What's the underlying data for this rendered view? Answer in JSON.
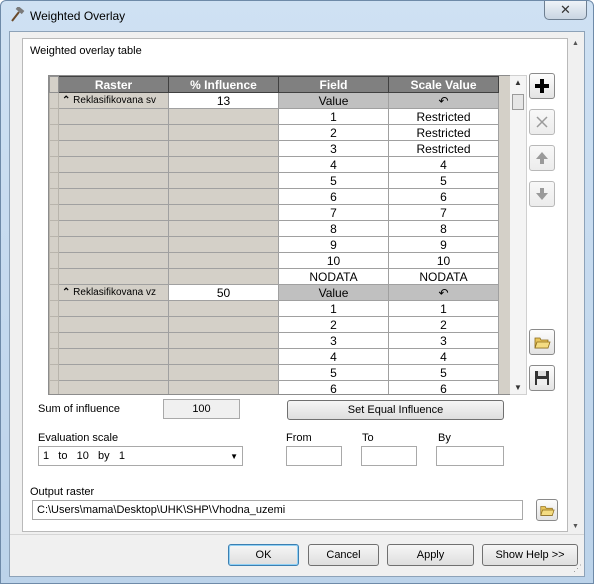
{
  "window": {
    "title": "Weighted Overlay",
    "close_glyph": "✕"
  },
  "panel": {
    "table_label": "Weighted overlay table",
    "columns": [
      "Raster",
      "% Influence",
      "Field",
      "Scale Value"
    ],
    "groups": [
      {
        "raster": "Reklasifikovana sv",
        "influence": "13",
        "field_header": "Value",
        "scale_header": "↶",
        "rows": [
          {
            "field": "1",
            "scale": "Restricted"
          },
          {
            "field": "2",
            "scale": "Restricted"
          },
          {
            "field": "3",
            "scale": "Restricted"
          },
          {
            "field": "4",
            "scale": "4"
          },
          {
            "field": "5",
            "scale": "5"
          },
          {
            "field": "6",
            "scale": "6"
          },
          {
            "field": "7",
            "scale": "7"
          },
          {
            "field": "8",
            "scale": "8"
          },
          {
            "field": "9",
            "scale": "9"
          },
          {
            "field": "10",
            "scale": "10"
          },
          {
            "field": "NODATA",
            "scale": "NODATA"
          }
        ]
      },
      {
        "raster": "Reklasifikovana vz",
        "influence": "50",
        "field_header": "Value",
        "scale_header": "↶",
        "rows": [
          {
            "field": "1",
            "scale": "1"
          },
          {
            "field": "2",
            "scale": "2"
          },
          {
            "field": "3",
            "scale": "3"
          },
          {
            "field": "4",
            "scale": "4"
          },
          {
            "field": "5",
            "scale": "5"
          },
          {
            "field": "6",
            "scale": "6"
          }
        ]
      }
    ],
    "sum_label": "Sum of influence",
    "sum_value": "100",
    "set_equal_label": "Set Equal Influence",
    "eval_label": "Evaluation scale",
    "eval_value": "1   to   10   by   1",
    "from_label": "From",
    "to_label": "To",
    "by_label": "By",
    "from_value": "",
    "to_value": "",
    "by_value": "",
    "output_label": "Output raster",
    "output_value": "C:\\Users\\mama\\Desktop\\UHK\\SHP\\Vhodna_uzemi"
  },
  "buttons": {
    "ok": "OK",
    "cancel": "Cancel",
    "apply": "Apply",
    "help": "Show Help >>"
  },
  "colors": {
    "titlebar": "#bcd3ea",
    "grid_header": "#808080",
    "dialog_bg": "#f0f0f0"
  }
}
